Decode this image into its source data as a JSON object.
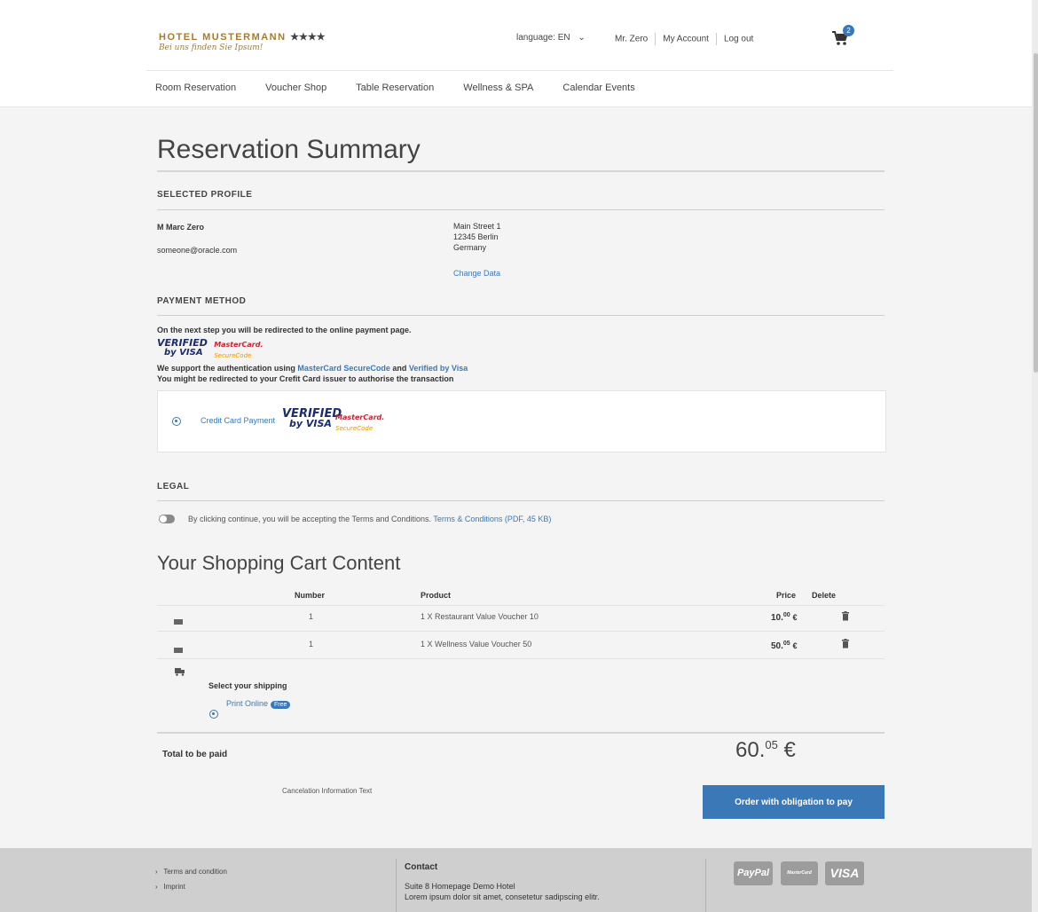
{
  "header": {
    "brand": "HOTEL MUSTERMANN",
    "stars": "★★★★",
    "tagline": "Bei uns finden Sie Ipsum!",
    "language": "language: EN",
    "user_name": "Mr. Zero",
    "my_account": "My Account",
    "logout": "Log out",
    "cart_count": "2"
  },
  "nav": [
    "Room Reservation",
    "Voucher Shop",
    "Table Reservation",
    "Wellness & SPA",
    "Calendar Events"
  ],
  "page_title": "Reservation Summary",
  "profile": {
    "heading": "SELECTED PROFILE",
    "name": "M Marc Zero",
    "email": "someone@oracle.com",
    "address_line1": "Main Street 1",
    "address_line2": "12345 Berlin",
    "address_line3": "Germany",
    "change_link": "Change Data"
  },
  "payment": {
    "heading": "PAYMENT METHOD",
    "redirect_note": "On the next step you will be redirected to the online payment page.",
    "support_pre": "We support the authentication using ",
    "mastercard_link": "MasterCard SecureCode",
    "support_and": " and ",
    "visa_link": "Verified by Visa",
    "issuer_note": "You might be redirected to your Crefit Card issuer to authorise the transaction",
    "option_label": "Credit Card Payment",
    "vbv_line1": "VERIFIED",
    "vbv_line2": "by VISA",
    "msc_line1": "MasterCard.",
    "msc_line2": "SecureCode"
  },
  "legal": {
    "heading": "LEGAL",
    "text": "By clicking continue, you will be accepting the Terms and Conditions.",
    "terms_link": "Terms & Conditions (PDF, 45 KB)"
  },
  "cart": {
    "title": "Your Shopping Cart Content",
    "columns": {
      "number": "Number",
      "product": "Product",
      "price": "Price",
      "delete": "Delete"
    },
    "rows": [
      {
        "number": "1",
        "product": "1 X Restaurant Value Voucher 10",
        "price_main": "10.",
        "price_cents": "00",
        "currency": "€"
      },
      {
        "number": "1",
        "product": "1 X Wellness Value Voucher 50",
        "price_main": "50.",
        "price_cents": "05",
        "currency": "€"
      }
    ],
    "shipping_label": "Select your shipping",
    "shipping_option": "Print Online",
    "shipping_badge": "Free",
    "total_label": "Total to be paid",
    "total_main": "60.",
    "total_cents": "05",
    "total_currency": "€",
    "cancel_info": "Cancelation Information Text",
    "order_button": "Order with obligation to pay"
  },
  "footer": {
    "links": [
      "Terms and condition",
      "Imprint"
    ],
    "contact_heading": "Contact",
    "contact_line1": "Suite 8 Homepage Demo Hotel",
    "contact_line2": "Lorem ipsum dolor sit amet, consetetur sadipscing elitr.",
    "paypal": "PayPal",
    "mastercard": "MasterCard",
    "visa": "VISA"
  }
}
